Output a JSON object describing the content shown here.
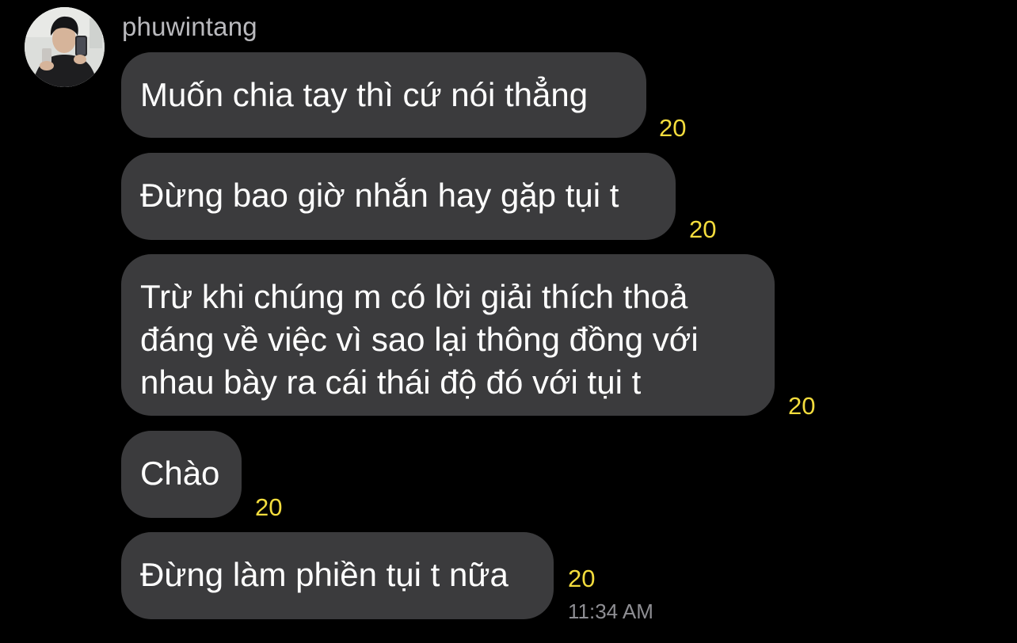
{
  "chat": {
    "sender": "phuwintang",
    "messages": [
      {
        "text": "Muốn chia tay thì cứ nói thẳng",
        "reactions": "20"
      },
      {
        "text": "Đừng bao giờ nhắn hay gặp tụi t",
        "reactions": "20"
      },
      {
        "text": "Trừ khi chúng m có lời giải thích thoả đáng về việc vì sao lại thông đồng với nhau bày ra cái thái độ đó với tụi t",
        "reactions": "20"
      },
      {
        "text": "Chào",
        "reactions": "20"
      },
      {
        "text": "Đừng làm phiền tụi t nữa",
        "reactions": "20"
      }
    ],
    "timestamp": "11:34 AM"
  },
  "colors": {
    "background": "#000000",
    "bubble": "#3b3b3d",
    "sender_name": "#b9b9bd",
    "reaction_count": "#f3dc3d",
    "timestamp": "#8e8e93"
  },
  "icons": {
    "avatar": "profile-photo"
  }
}
